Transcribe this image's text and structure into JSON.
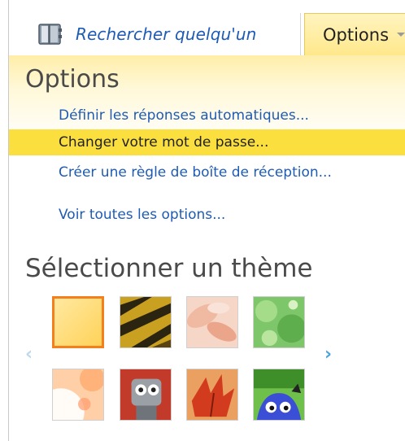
{
  "header": {
    "search_label": "Rechercher quelqu'un",
    "options_tab_label": "Options"
  },
  "menu": {
    "heading": "Options",
    "links": [
      "Définir les réponses automatiques...",
      "Changer votre mot de passe...",
      "Créer une règle de boîte de réception...",
      "Voir toutes les options..."
    ],
    "highlighted_index": 1
  },
  "themes": {
    "heading": "Sélectionner un thème",
    "selected_index": 0,
    "items": [
      "theme-sunny",
      "theme-tiger",
      "theme-petals",
      "theme-leaves",
      "theme-bubbles",
      "theme-robot",
      "theme-autumn",
      "theme-monster"
    ]
  },
  "colors": {
    "accent": "#1e5bb5",
    "highlight": "#fbdf3f",
    "selection": "#f47f1f"
  }
}
